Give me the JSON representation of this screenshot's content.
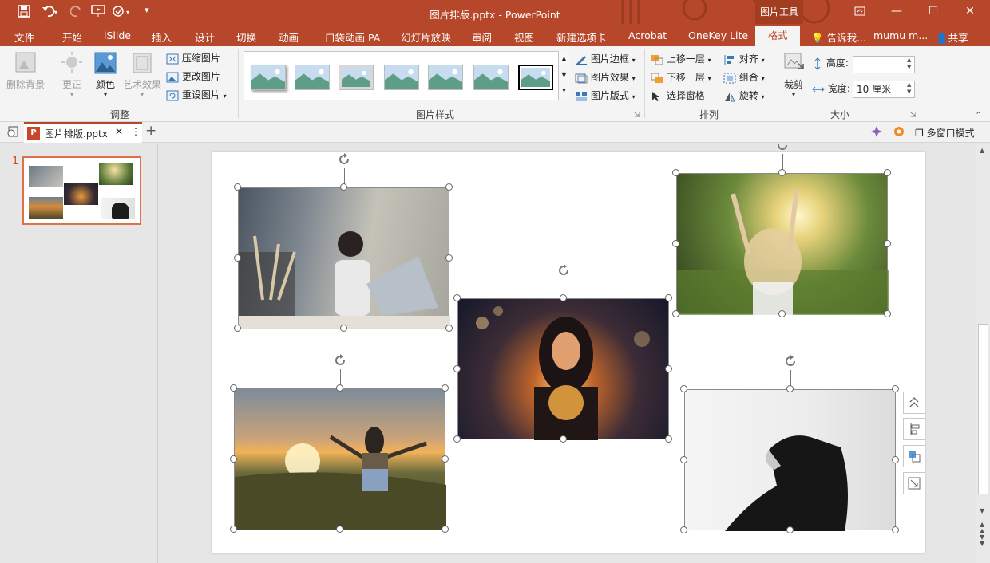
{
  "app": {
    "doc_title": "图片排版.pptx - PowerPoint",
    "context_tools": "图片工具"
  },
  "ribbon_tabs": [
    "文件",
    "开始",
    "iSlide",
    "插入",
    "设计",
    "切换",
    "动画",
    "口袋动画 PA",
    "幻灯片放映",
    "审阅",
    "视图",
    "新建选项卡",
    "Acrobat",
    "OneKey Lite",
    "格式"
  ],
  "active_tab": "格式",
  "tell_me": "告诉我...",
  "user": "mumu m...",
  "share": "共享",
  "groups": {
    "adjust": {
      "label": "调整",
      "remove_bg": "删除背景",
      "corrections": "更正",
      "color": "颜色",
      "artistic": "艺术效果",
      "compress": "压缩图片",
      "change": "更改图片",
      "reset": "重设图片"
    },
    "styles": {
      "label": "图片样式",
      "border": "图片边框",
      "effects": "图片效果",
      "layout": "图片版式"
    },
    "arrange": {
      "label": "排列",
      "forward": "上移一层",
      "backward": "下移一层",
      "pane": "选择窗格",
      "align": "对齐",
      "group": "组合",
      "rotate": "旋转"
    },
    "size": {
      "label": "大小",
      "crop": "裁剪",
      "height_label": "高度:",
      "height_value": "",
      "width_label": "宽度:",
      "width_value": "10 厘米"
    }
  },
  "doc_tab": {
    "name": "图片排版.pptx",
    "multi_window": "多窗口模式"
  },
  "slides": [
    {
      "number": "1"
    }
  ],
  "colors": {
    "accent": "#b7472a",
    "selection": "#e0704a",
    "ribbon_bg": "#f4f4f4"
  }
}
